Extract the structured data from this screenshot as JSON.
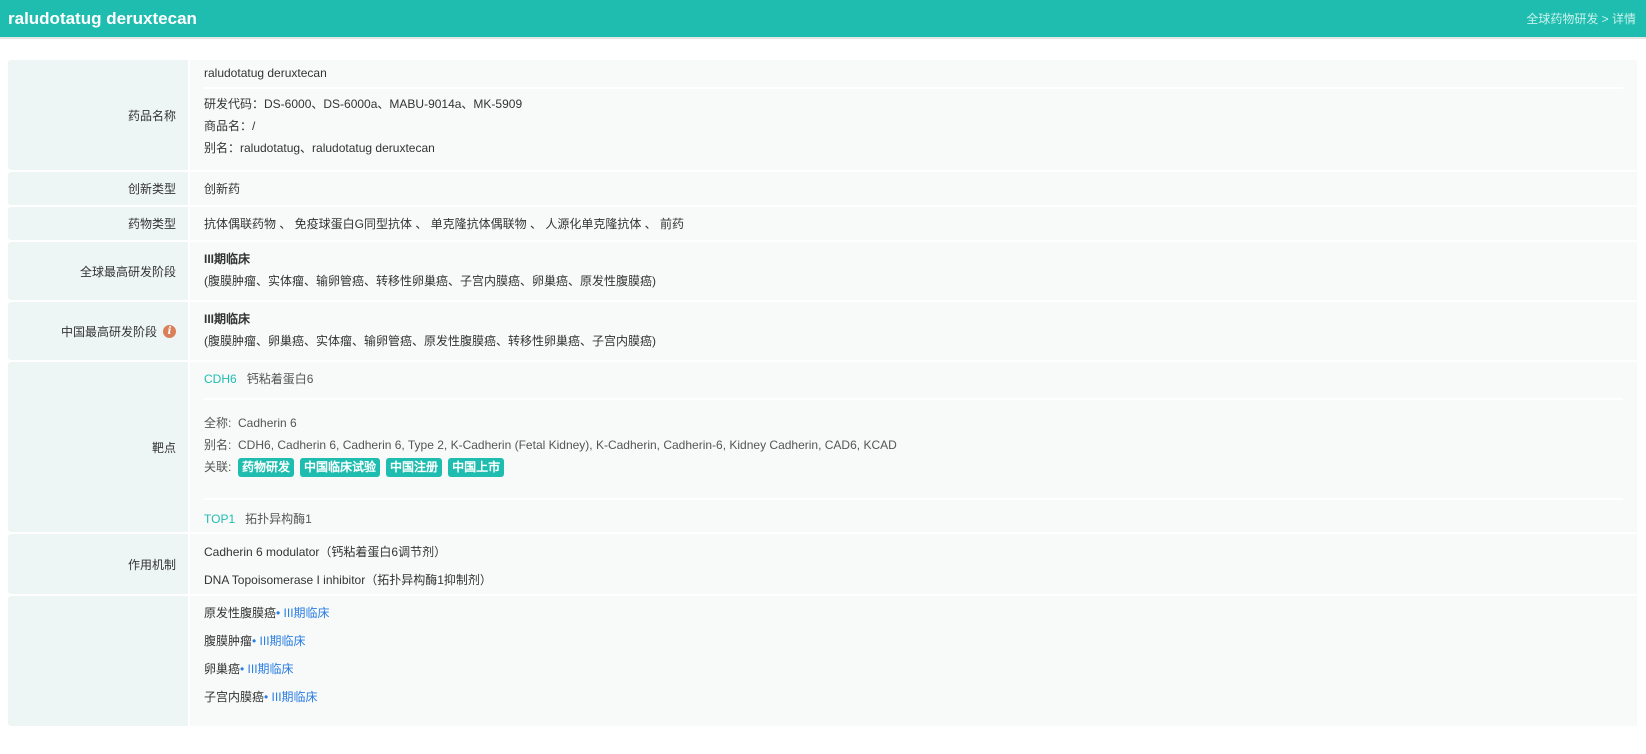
{
  "header": {
    "title": "raludotatug deruxtecan",
    "breadcrumb": "全球药物研发 > 详情"
  },
  "drug_name": {
    "label": "药品名称",
    "name": "raludotatug deruxtecan",
    "codes": "研发代码：DS-6000、DS-6000a、MABU-9014a、MK-5909",
    "trade": "商品名：/",
    "alias": "别名：raludotatug、raludotatug deruxtecan"
  },
  "innovation": {
    "label": "创新类型",
    "value": "创新药"
  },
  "drug_type": {
    "label": "药物类型",
    "value": "抗体偶联药物 、 免疫球蛋白G同型抗体 、 单克隆抗体偶联物 、 人源化单克隆抗体 、 前药"
  },
  "global_stage": {
    "label": "全球最高研发阶段",
    "stage": "III期临床",
    "indications": "(腹膜肿瘤、实体瘤、输卵管癌、转移性卵巢癌、子宫内膜癌、卵巢癌、原发性腹膜癌)"
  },
  "china_stage": {
    "label": "中国最高研发阶段",
    "stage": "III期临床",
    "indications": "(腹膜肿瘤、卵巢癌、实体瘤、输卵管癌、原发性腹膜癌、转移性卵巢癌、子宫内膜癌)",
    "info_icon": "info-icon"
  },
  "target": {
    "label": "靶点",
    "t1": {
      "code": "CDH6",
      "name": "钙粘着蛋白6",
      "fullname_label": "全称:",
      "fullname": "Cadherin 6",
      "alias_label": "别名:",
      "alias": "CDH6, Cadherin 6, Cadherin 6, Type 2, K-Cadherin (Fetal Kidney), K-Cadherin, Cadherin-6, Kidney Cadherin, CAD6, KCAD",
      "links_label": "关联:",
      "links": [
        "药物研发",
        "中国临床试验",
        "中国注册",
        "中国上市"
      ]
    },
    "t2": {
      "code": "TOP1",
      "name": "拓扑异构酶1"
    }
  },
  "mechanism": {
    "label": "作用机制",
    "items": [
      "Cadherin 6 modulator（钙粘着蛋白6调节剂）",
      "DNA Topoisomerase I inhibitor（拓扑异构酶1抑制剂）"
    ]
  },
  "indications": {
    "items": [
      {
        "name": "原发性腹膜癌",
        "stage": "• III期临床"
      },
      {
        "name": "腹膜肿瘤",
        "stage": "• III期临床"
      },
      {
        "name": "卵巢癌",
        "stage": "• III期临床"
      },
      {
        "name": "子宫内膜癌",
        "stage": "• III期临床"
      }
    ]
  }
}
